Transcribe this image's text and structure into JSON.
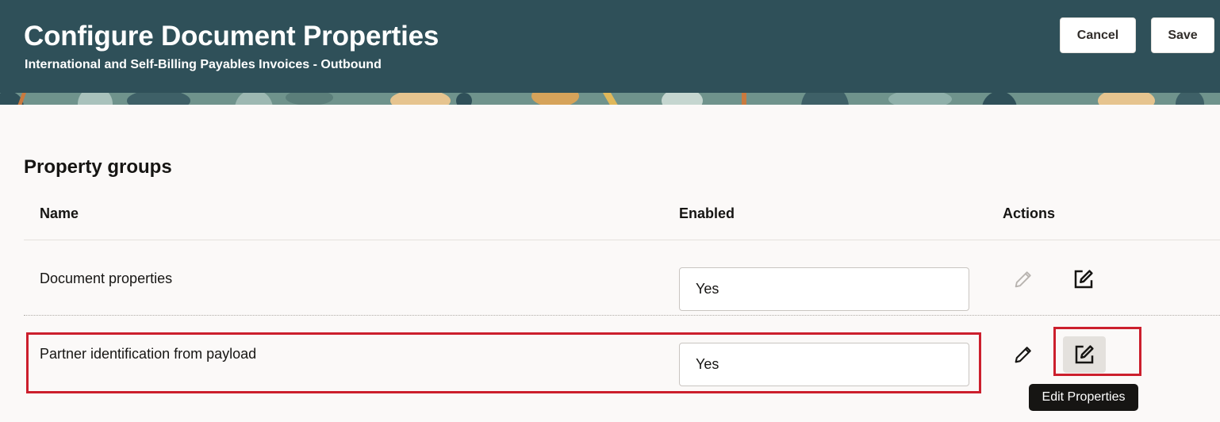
{
  "header": {
    "title": "Configure Document Properties",
    "subtitle": "International and Self-Billing Payables Invoices - Outbound",
    "cancel_label": "Cancel",
    "save_label": "Save"
  },
  "section": {
    "title": "Property groups"
  },
  "table": {
    "columns": [
      "Name",
      "Enabled",
      "Actions"
    ],
    "rows": [
      {
        "name": "Document properties",
        "enabled": "Yes",
        "edit_icon": "pencil-icon-disabled",
        "properties_icon": "edit-square-icon"
      },
      {
        "name": "Partner identification from payload",
        "enabled": "Yes",
        "edit_icon": "pencil-icon",
        "properties_icon": "edit-square-icon"
      }
    ]
  },
  "tooltip": {
    "text": "Edit Properties"
  },
  "colors": {
    "header_bg": "#2f5059",
    "highlight": "#cc1f2d",
    "page_bg": "#fbf9f8"
  }
}
